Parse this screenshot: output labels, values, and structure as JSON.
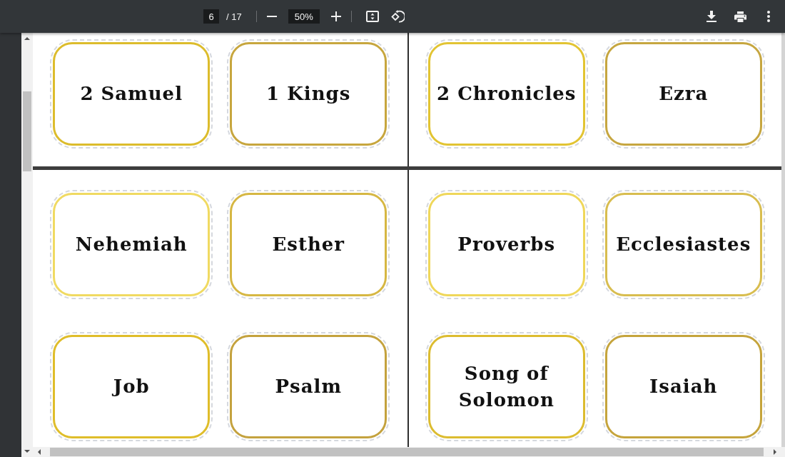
{
  "toolbar": {
    "page_number": "6",
    "page_count": "/ 17",
    "zoom": "50%"
  },
  "pages": [
    {
      "sheets": [
        {
          "cards": [
            {
              "label": "2 Samuel",
              "color": "#dcbc2c"
            },
            {
              "label": "1 Kings",
              "color": "#c7a63e"
            }
          ]
        },
        {
          "cards": [
            {
              "label": "2 Chronicles",
              "color": "#e2c433"
            },
            {
              "label": "Ezra",
              "color": "#c6a640"
            }
          ]
        }
      ]
    },
    {
      "sheets": [
        {
          "cards": [
            {
              "label": "Nehemiah",
              "color": "#f0da62"
            },
            {
              "label": "Esther",
              "color": "#d6b743"
            },
            {
              "label": "Job",
              "color": "#dfbd2a"
            },
            {
              "label": "Psalm",
              "color": "#c4a23e"
            }
          ]
        },
        {
          "cards": [
            {
              "label": "Proverbs",
              "color": "#efd75a"
            },
            {
              "label": "Ecclesiastes",
              "color": "#d8bd4f"
            },
            {
              "label": "Song of\nSolomon",
              "color": "#dcbc30"
            },
            {
              "label": "Isaiah",
              "color": "#c5a43c"
            }
          ]
        }
      ]
    }
  ]
}
